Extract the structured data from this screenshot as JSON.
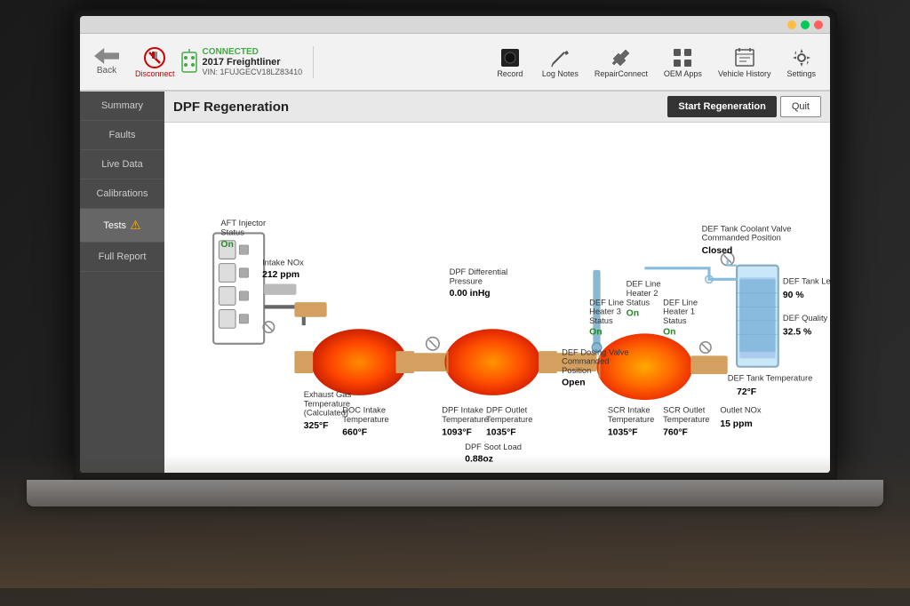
{
  "titlebar": {
    "min_label": "–",
    "max_label": "□",
    "close_label": "×"
  },
  "toolbar": {
    "back_label": "Back",
    "connected_label": "CONNECTED",
    "vehicle_name": "2017 Freightliner",
    "vin": "VIN: 1FUJGECV18LZ83410",
    "disconnect_label": "Disconnect",
    "actions": [
      {
        "id": "record",
        "label": "Record",
        "icon": "⬛"
      },
      {
        "id": "log-notes",
        "label": "Log Notes",
        "icon": "✏️"
      },
      {
        "id": "repair-connect",
        "label": "RepairConnect",
        "icon": "🔧"
      },
      {
        "id": "oem-apps",
        "label": "OEM Apps",
        "icon": "⊞"
      },
      {
        "id": "vehicle-history",
        "label": "Vehicle History",
        "icon": "📋"
      },
      {
        "id": "settings",
        "label": "Settings",
        "icon": "⚙️"
      }
    ]
  },
  "sidebar": {
    "items": [
      {
        "id": "summary",
        "label": "Summary",
        "active": false
      },
      {
        "id": "faults",
        "label": "Faults",
        "active": false
      },
      {
        "id": "live-data",
        "label": "Live Data",
        "active": false
      },
      {
        "id": "calibrations",
        "label": "Calibrations",
        "active": false
      },
      {
        "id": "tests",
        "label": "Tests",
        "active": true,
        "has_warning": true
      },
      {
        "id": "full-report",
        "label": "Full Report",
        "active": false
      }
    ]
  },
  "page": {
    "title": "DPF Regeneration",
    "start_regen_label": "Start Regeneration",
    "quit_label": "Quit"
  },
  "diagram": {
    "labels": {
      "aft_injector_status": "AFT Injector Status",
      "aft_injector_value": "On",
      "intake_nox_label": "Intake NOx",
      "intake_nox_value": "212 ppm",
      "exhaust_gas_temp_label": "Exhaust Gas Temperature (Calculated)",
      "exhaust_gas_temp_value": "325°F",
      "doc_intake_temp_label": "DOC Intake Temperature",
      "doc_intake_temp_value": "660°F",
      "dpf_differential_pressure_label": "DPF Differential Pressure",
      "dpf_differential_pressure_value": "0.00 inHg",
      "dpf_intake_temp_label": "DPF Intake Temperature",
      "dpf_intake_temp_value": "1093°F",
      "dpf_outlet_temp_label": "DPF Outlet Temperature",
      "dpf_outlet_temp_value": "1035°F",
      "dpf_soot_load_label": "DPF Soot Load",
      "dpf_soot_load_value": "0.88oz",
      "def_line_heater3_label": "DEF Line Heater 3 Status",
      "def_line_heater3_value": "On",
      "def_line_heater2_label": "DEF Line Heater 2 Status",
      "def_line_heater2_value": "On",
      "def_line_heater1_label": "DEF Line Heater 1 Status",
      "def_line_heater1_value": "On",
      "def_dosing_valve_label": "DEF Dosing Valve Commanded Position",
      "def_dosing_valve_value": "Open",
      "scr_intake_temp_label": "SCR Intake Temperature",
      "scr_intake_temp_value": "1035°F",
      "scr_outlet_temp_label": "SCR Outlet Temperature",
      "scr_outlet_temp_value": "760°F",
      "outlet_nox_label": "Outlet NOx",
      "outlet_nox_value": "15 ppm",
      "def_tank_coolant_valve_label": "DEF Tank Coolant Valve Commanded Position",
      "def_tank_coolant_valve_value": "Closed",
      "def_tank_level_label": "DEF Tank Level",
      "def_tank_level_value": "90 %",
      "def_quality_label": "DEF Quality",
      "def_quality_value": "32.5 %",
      "def_tank_temp_label": "DEF Tank Temperature",
      "def_tank_temp_value": "72°F"
    }
  }
}
